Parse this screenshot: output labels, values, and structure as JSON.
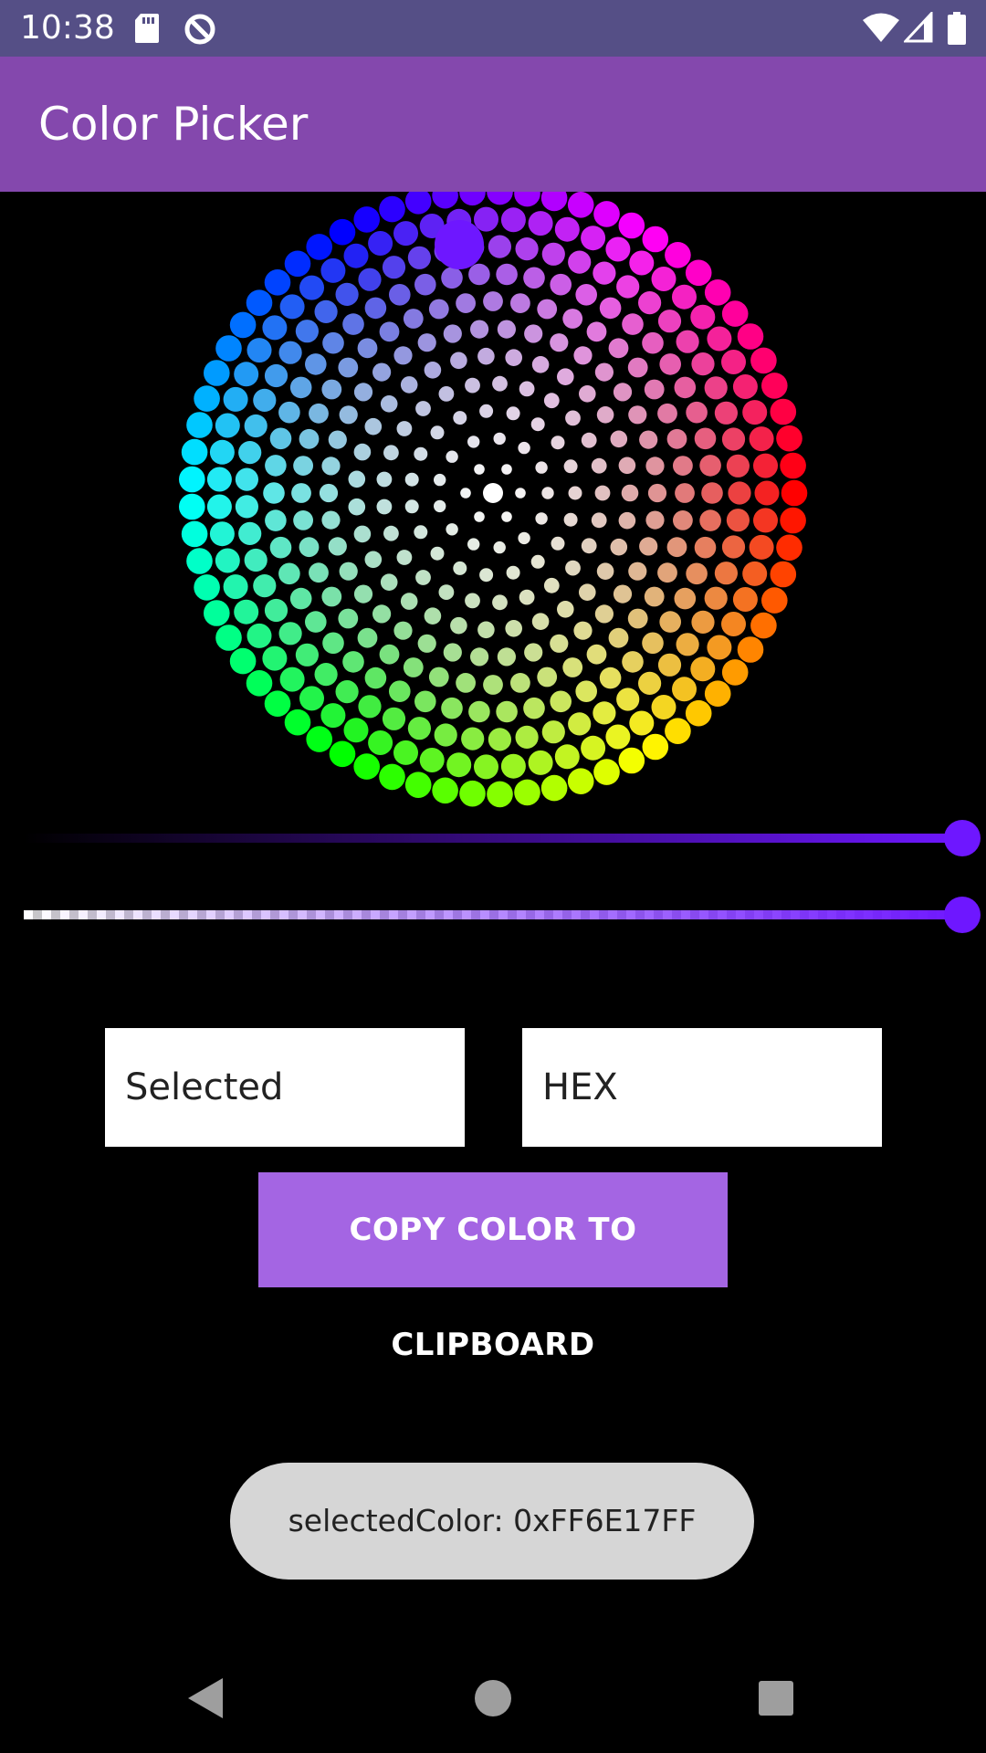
{
  "status_bar": {
    "time": "10:38",
    "background": "#554F86",
    "icons_left": [
      "sd-card-icon",
      "data-saver-icon"
    ],
    "icons_right": [
      "wifi-icon",
      "cell-signal-icon",
      "battery-icon"
    ]
  },
  "app_bar": {
    "title": "Color Picker",
    "background": "#8448AD"
  },
  "color_wheel": {
    "selected_color": "#6E17FF"
  },
  "brightness_slider": {
    "value": 1.0,
    "color_start": "#000000",
    "color_end": "#6E17FF"
  },
  "alpha_slider": {
    "value": 1.0,
    "color_end": "#6E17FF"
  },
  "fields": {
    "selected_placeholder": "Selected",
    "hex_placeholder": "HEX"
  },
  "copy_button": {
    "label": "COPY COLOR TO CLIPBOARD",
    "background": "#A465E3"
  },
  "toast": {
    "message": "selectedColor: 0xFF6E17FF"
  },
  "nav_bar": {
    "icons": [
      "back-icon",
      "home-icon",
      "recents-icon"
    ]
  }
}
